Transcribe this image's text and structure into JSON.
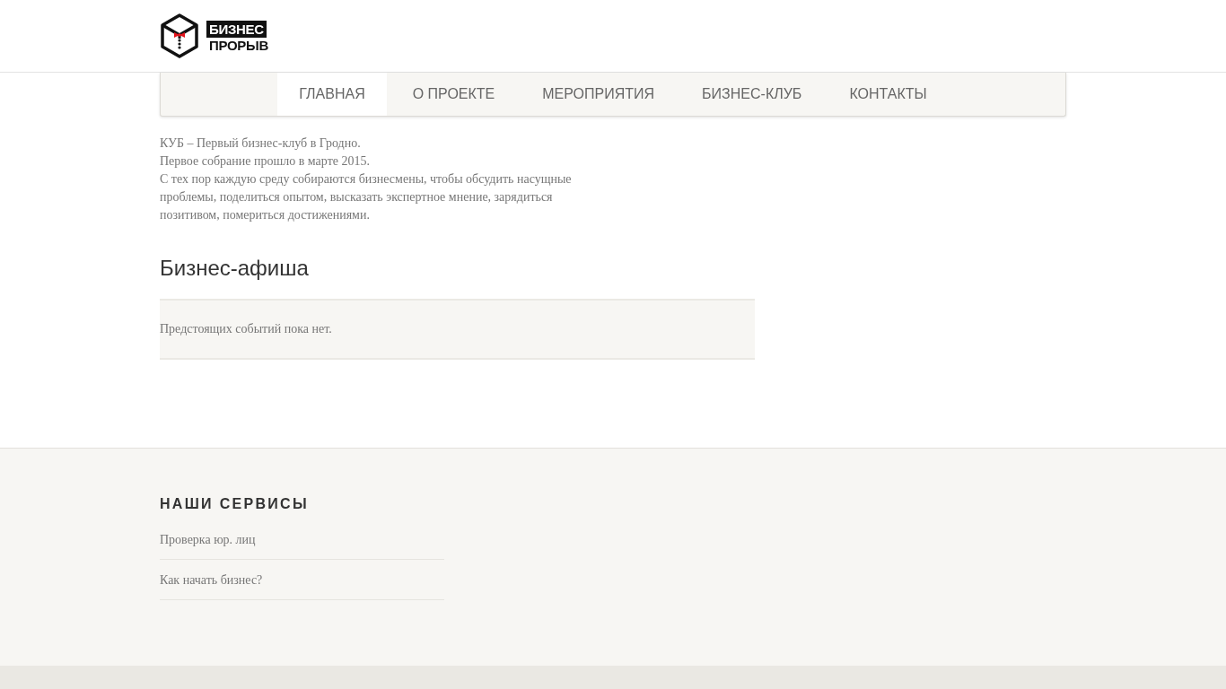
{
  "header": {
    "logo": {
      "line_1": "БИЗНЕС",
      "line_2": "ПРОРЫВ"
    }
  },
  "nav": {
    "items": [
      {
        "label": "ГЛАВНАЯ",
        "selected": true
      },
      {
        "label": "О ПРОЕКТЕ",
        "selected": false
      },
      {
        "label": "МЕРОПРИЯТИЯ",
        "selected": false
      },
      {
        "label": "БИЗНЕС-КЛУБ",
        "selected": false
      },
      {
        "label": "КОНТАКТЫ",
        "selected": false
      }
    ]
  },
  "intro": {
    "lines": [
      "КУБ – Первый бизнес-клуб в Гродно.",
      "Первое собрание прошло в марте 2015.",
      "С тех пор каждую среду собираются бизнесмены, чтобы обсудить насущные проблемы, поделиться опытом, высказать экспертное мнение, зарядиться позитивом, помериться достижениями."
    ]
  },
  "events": {
    "title": "Бизнес-афиша",
    "empty_message": "Предстоящих событий пока нет."
  },
  "footer": {
    "services": {
      "title": "НАШИ СЕРВИСЫ",
      "links": [
        "Проверка юр. лиц",
        "Как начать бизнес?"
      ]
    }
  }
}
